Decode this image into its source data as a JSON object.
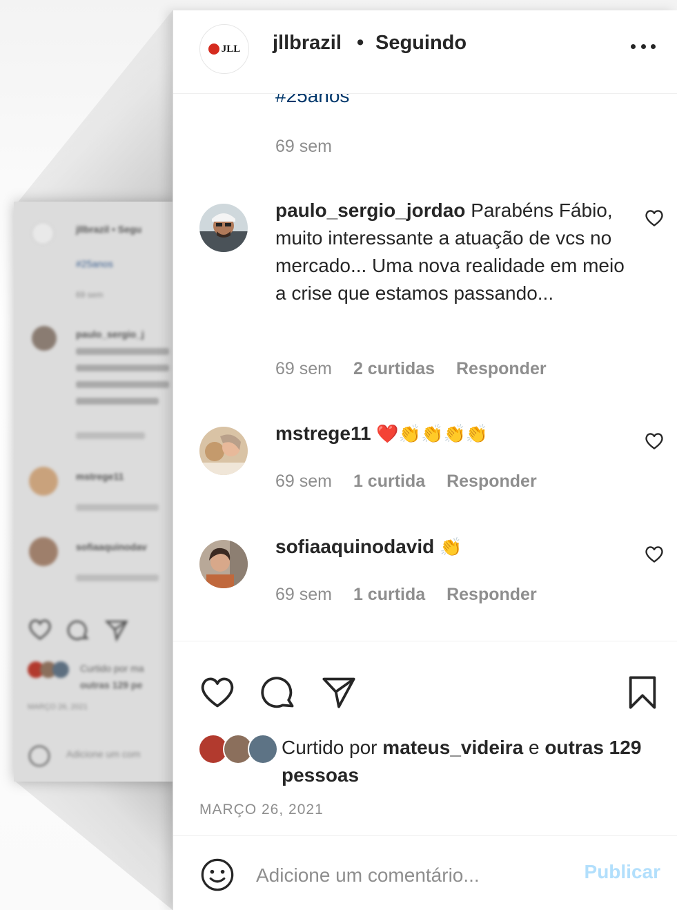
{
  "post": {
    "username": "jllbrazil",
    "separator": "•",
    "follow_status": "Seguindo",
    "avatar_logo_text": "JLL"
  },
  "caption": {
    "hashtag": "#25anos",
    "time": "69 sem"
  },
  "comments": [
    {
      "username": "paulo_sergio_jordao",
      "text": "Parabéns Fábio, muito interessante a atuação de vcs no mercado... Uma nova realidade em meio a crise que estamos passando...",
      "time": "69 sem",
      "likes": "2 curtidas",
      "reply": "Responder"
    },
    {
      "username": "mstrege11",
      "text": "❤️👏👏👏👏",
      "time": "69 sem",
      "likes": "1 curtida",
      "reply": "Responder"
    },
    {
      "username": "sofiaaquinodavid",
      "text": "👏",
      "time": "69 sem",
      "likes": "1 curtida",
      "reply": "Responder"
    }
  ],
  "likes": {
    "prefix": "Curtido por",
    "user": "mateus_videira",
    "suffix": "e",
    "others": "outras 129 pessoas"
  },
  "date": "MARÇO 26, 2021",
  "add_comment": {
    "placeholder": "Adicione um comentário...",
    "publish": "Publicar"
  },
  "blurred_preview": {
    "username": "jllbrazil • Segu",
    "hashtag": "#25anos",
    "time": "69 sem",
    "comment1_user": "paulo_sergio_j",
    "comment2_user": "mstrege11",
    "comment3_user": "sofiaaquinodav",
    "likes_line1": "Curtido por ma",
    "likes_line2": "outras 129 pe",
    "date": "MARÇO 26, 2021",
    "input_placeholder": "Adicione um com"
  },
  "icons": {
    "more": "more-options-icon",
    "heart": "heart-icon",
    "comment": "comment-icon",
    "share": "share-icon",
    "bookmark": "bookmark-icon",
    "emoji": "emoji-icon"
  },
  "colors": {
    "link": "#00376b",
    "muted": "#8e8e8e",
    "publish_disabled": "#b2dffc",
    "brand_red": "#d52b1e"
  }
}
